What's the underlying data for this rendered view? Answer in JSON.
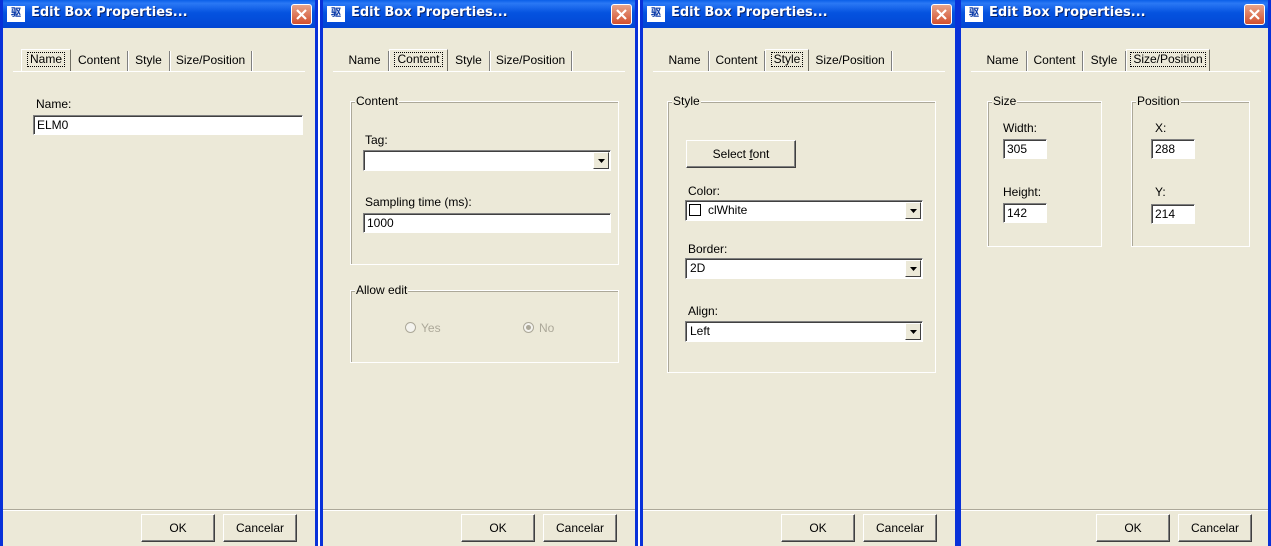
{
  "window_title": "Edit Box Properties...",
  "app_icon_glyph": "驱",
  "tabs": [
    "Name",
    "Content",
    "Style",
    "Size/Position"
  ],
  "buttons": {
    "ok": "OK",
    "cancel": "Cancelar"
  },
  "name_tab": {
    "label": "Name:",
    "value": "ELM0"
  },
  "content_tab": {
    "group_content": "Content",
    "tag_label": "Tag:",
    "tag_value": "",
    "sampling_label": "Sampling time (ms):",
    "sampling_value": "1000",
    "group_allow_edit": "Allow edit",
    "yes_label": "Yes",
    "no_label": "No",
    "allow_edit_selected": "No"
  },
  "style_tab": {
    "group_style": "Style",
    "select_font_prefix": "Select ",
    "select_font_accel": "f",
    "select_font_suffix": "ont",
    "color_label": "Color:",
    "color_value": "clWhite",
    "color_swatch": "#ffffff",
    "border_label": "Border:",
    "border_value": "2D",
    "align_label": "Align:",
    "align_value": "Left"
  },
  "sizepos_tab": {
    "group_size": "Size",
    "width_label": "Width:",
    "width_value": "305",
    "height_label": "Height:",
    "height_value": "142",
    "group_position": "Position",
    "x_label": "X:",
    "x_value": "288",
    "y_label": "Y:",
    "y_value": "214"
  },
  "colors": {
    "title_bar": "#0553e0",
    "dialog_bg": "#ece9d8",
    "window_border": "#0831d9",
    "close_button": "#d2502e"
  }
}
